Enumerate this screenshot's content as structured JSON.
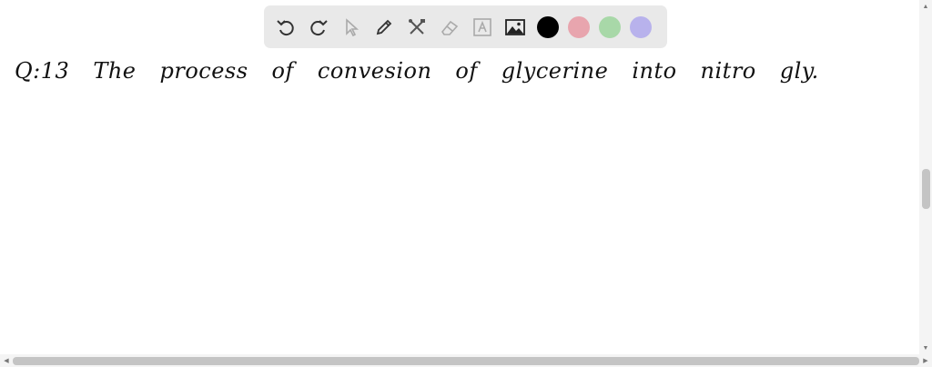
{
  "toolbar": {
    "tools": [
      "undo-icon",
      "redo-icon",
      "select-icon",
      "pen-icon",
      "tools-icon",
      "eraser-icon",
      "text-icon",
      "image-icon"
    ],
    "colors": [
      "#000000",
      "#e8a5ae",
      "#a8d8a8",
      "#b8b2ec"
    ]
  },
  "canvas": {
    "words": [
      "Q:13",
      "The",
      "process",
      "of",
      "convesion",
      "of",
      "glycerine",
      "into",
      "nitro",
      "gly."
    ]
  },
  "scrollbars": {
    "vertical_position": 0.47,
    "horizontal_position": 0.0
  }
}
